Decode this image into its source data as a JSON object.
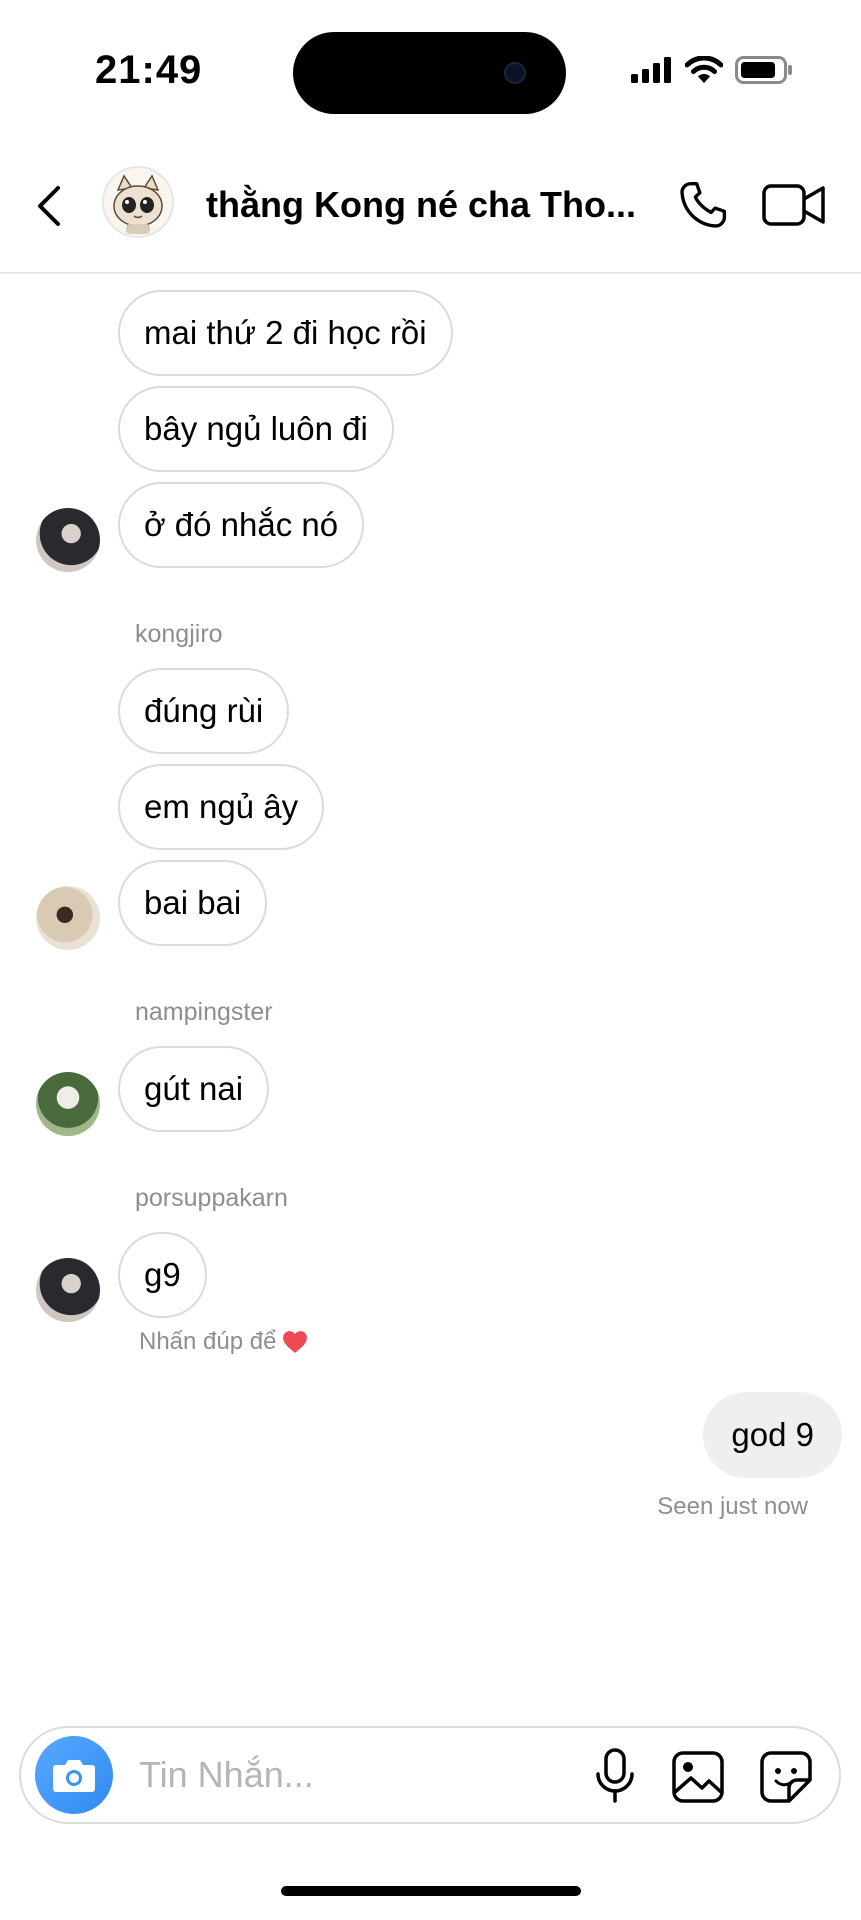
{
  "status_bar": {
    "time": "21:49"
  },
  "header": {
    "title": "thằng Kong né cha Tho...",
    "back_icon": "chevron-left-icon",
    "call_icon": "phone-icon",
    "video_icon": "video-camera-icon"
  },
  "messages": [
    {
      "text": "mai thứ 2 đi học rồi"
    },
    {
      "text": "bây ngủ luôn đi"
    },
    {
      "text": "ở đó nhắc nó"
    },
    {
      "sender": "kongjiro"
    },
    {
      "text": "đúng rùi"
    },
    {
      "text": "em ngủ ây"
    },
    {
      "text": "bai bai"
    },
    {
      "sender": "nampingster"
    },
    {
      "text": "gút nai"
    },
    {
      "sender": "porsuppakarn"
    },
    {
      "text": "g9"
    }
  ],
  "double_tap_hint": "Nhấn đúp để",
  "outgoing": {
    "text": "god 9",
    "seen": "Seen just now"
  },
  "composer": {
    "placeholder": "Tin Nhắn...",
    "icons": [
      "camera-icon",
      "microphone-icon",
      "gallery-icon",
      "sticker-icon"
    ]
  },
  "colors": {
    "camera_button": "#3797f0",
    "heart": "#ed4956",
    "bubble_border": "#dbdbdb",
    "muted_text": "#8e8e8e"
  }
}
